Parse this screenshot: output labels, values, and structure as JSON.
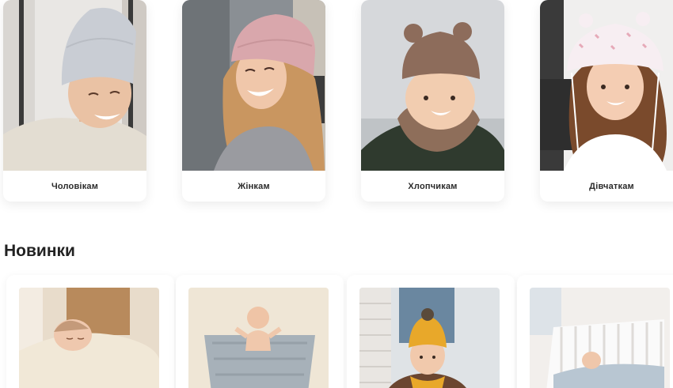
{
  "categories": [
    {
      "label": "Чоловікам",
      "photo": "man-in-grey-beanie"
    },
    {
      "label": "Жінкам",
      "photo": "woman-in-pink-beanie"
    },
    {
      "label": "Хлопчикам",
      "photo": "boy-in-bear-ear-hat"
    },
    {
      "label": "Дівчаткам",
      "photo": "girl-in-panama-hat"
    }
  ],
  "section": {
    "title": "Новинки"
  },
  "new_items": [
    {
      "photo": "baby-under-cream-blanket"
    },
    {
      "photo": "baby-on-grey-knit-blanket"
    },
    {
      "photo": "child-in-yellow-beanie"
    },
    {
      "photo": "baby-in-crib"
    }
  ],
  "colors": {
    "background": "#ffffff",
    "card_shadow": "rgba(0,0,0,0.08)",
    "text": "#2b2b2b"
  }
}
